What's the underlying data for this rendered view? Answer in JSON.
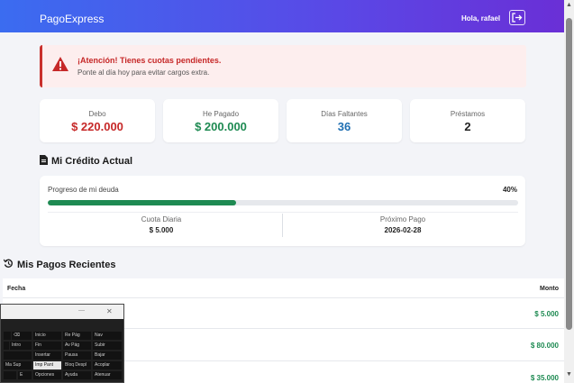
{
  "navbar": {
    "brand": "PagoExpress",
    "greeting": "Hola, rafael"
  },
  "alert": {
    "title": "¡Atención! Tienes cuotas pendientes.",
    "text": "Ponte al día hoy para evitar cargos extra."
  },
  "stats": [
    {
      "label": "Debo",
      "value": "$ 220.000",
      "color": "#c62828"
    },
    {
      "label": "He Pagado",
      "value": "$ 200.000",
      "color": "#1e8a52"
    },
    {
      "label": "Días Faltantes",
      "value": "36",
      "color": "#1f6fb2"
    },
    {
      "label": "Préstamos",
      "value": "2",
      "color": "#222222"
    }
  ],
  "credit": {
    "title": "Mi Crédito Actual",
    "progress_label": "Progreso de mi deuda",
    "progress_pct_text": "40%",
    "progress_fraction": 0.4,
    "cuota_label": "Cuota Diaria",
    "cuota_value": "$ 5.000",
    "proximo_label": "Próximo Pago",
    "proximo_value": "2026-02-28"
  },
  "payments": {
    "title": "Mis Pagos Recientes",
    "col_fecha": "Fecha",
    "col_monto": "Monto",
    "rows": [
      {
        "monto": "$ 5.000"
      },
      {
        "monto": "$ 80.000"
      },
      {
        "monto": "$ 35.000"
      }
    ]
  },
  "osk": {
    "keys": [
      "⌫",
      "Inicio",
      "Re Pág",
      "Nav",
      "Intro",
      "Fin",
      "Av Pág",
      "Subir",
      "Insertar",
      "Pausa",
      "Bajar",
      "Ma Sup",
      "Imp Pant",
      "Bloq Despl",
      "Acoplar",
      "Opciones",
      "Ayuda",
      "Atenuar",
      "E"
    ]
  },
  "colors": {
    "accent_start": "#3b6cf0",
    "accent_end": "#6a2fd6",
    "danger": "#c62828",
    "success": "#1e8a52",
    "info": "#1f6fb2"
  }
}
